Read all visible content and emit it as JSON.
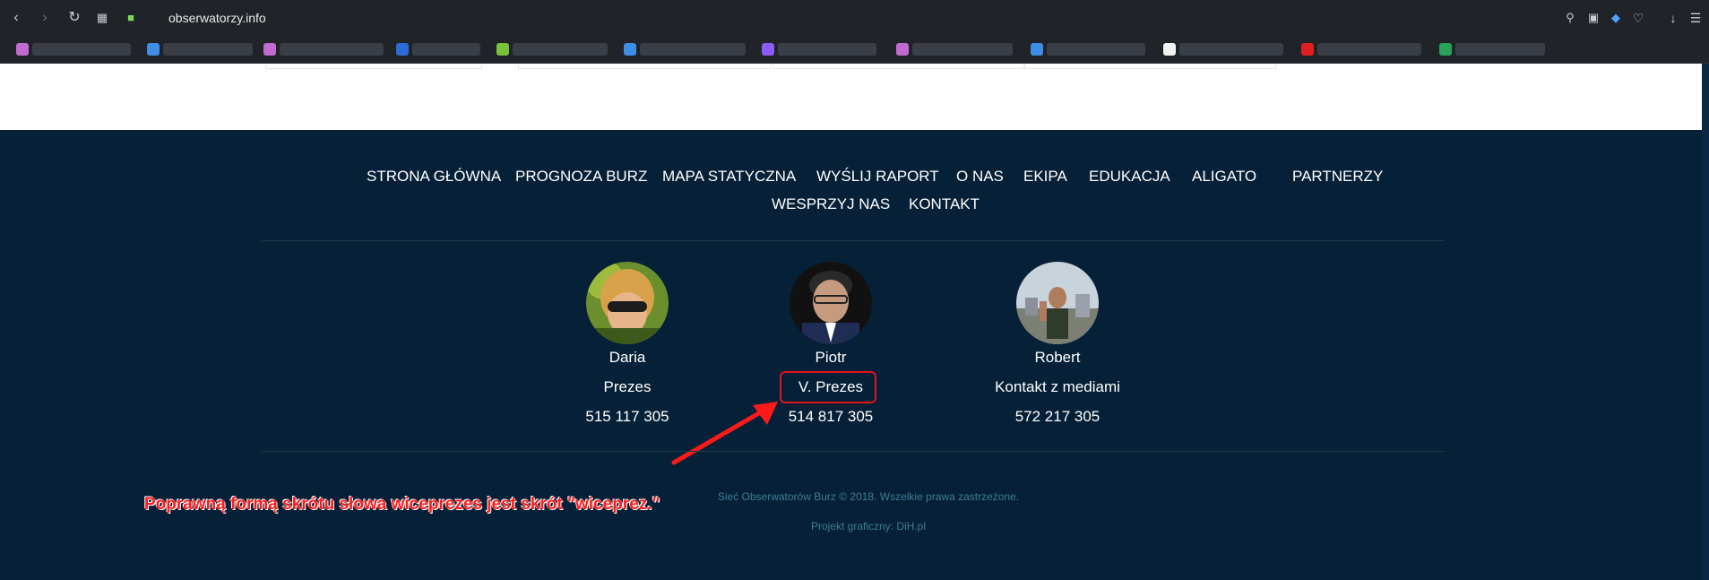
{
  "browser": {
    "url": "obserwatorzy.info"
  },
  "footer_nav": {
    "items": [
      "STRONA GŁÓWNA",
      "PROGNOZA BURZ",
      "MAPA STATYCZNA",
      "WYŚLIJ RAPORT",
      "O NAS",
      "EKIPA",
      "EDUKACJA",
      "ALIGATO",
      "PARTNERZY",
      "WESPRZYJ NAS",
      "KONTAKT"
    ]
  },
  "team": [
    {
      "name": "Daria",
      "role": "Prezes",
      "phone": "515 117 305"
    },
    {
      "name": "Piotr",
      "role": "V. Prezes",
      "phone": "514 817 305"
    },
    {
      "name": "Robert",
      "role": "Kontakt z mediami",
      "phone": "572 217 305"
    }
  ],
  "annotation": {
    "text": "Poprawną formą skrótu słowa wiceprezes jest skrót \"wiceprez.\"",
    "color": "#ff1a1a"
  },
  "copyright": "Sieć Obserwatorów Burz © 2018. Wszelkie prawa zastrzeżone.",
  "credit": "Projekt graficzny: DiH.pl",
  "colors": {
    "footer_bg": "#062038",
    "browser_bg": "#202327",
    "accent": "#e0161b"
  }
}
